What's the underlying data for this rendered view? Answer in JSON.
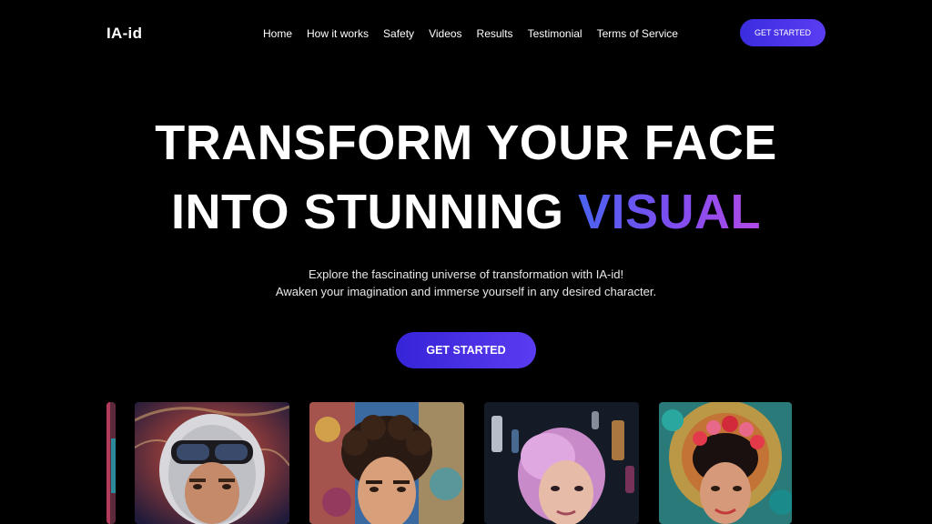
{
  "header": {
    "logo": "IA-id",
    "nav": [
      "Home",
      "How it works",
      "Safety",
      "Videos",
      "Results",
      "Testimonial",
      "Terms of Service"
    ],
    "cta_label": "GET STARTED"
  },
  "hero": {
    "title_line1": "TRANSFORM YOUR FACE",
    "title_line2_prefix": "INTO STUNNING",
    "title_line2_accent": "VISUAL",
    "subtitle_line1": "Explore the fascinating universe of transformation with IA-id!",
    "subtitle_line2": "Awaken your imagination and immerse yourself in any desired character.",
    "cta_label": "GET STARTED"
  },
  "gallery": {
    "items": [
      "astronaut-portrait",
      "curly-hair-portrait",
      "pink-hair-portrait",
      "flower-crown-portrait"
    ]
  },
  "colors": {
    "background": "#000000",
    "accent_start": "#4a63f0",
    "accent_end": "#b24ae6",
    "button": "#4b33ea"
  }
}
